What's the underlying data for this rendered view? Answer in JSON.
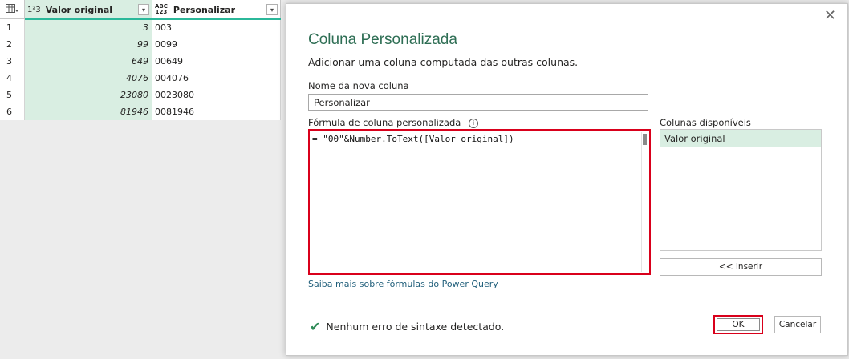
{
  "grid": {
    "columns": [
      {
        "type_label": "1²3",
        "name": "Valor original"
      },
      {
        "type_label": "ABC 123",
        "type_top": "ABC",
        "type_bottom": "123",
        "name": "Personalizar"
      }
    ],
    "rows": [
      {
        "index": "1",
        "valor": "3",
        "personalizar": "003"
      },
      {
        "index": "2",
        "valor": "99",
        "personalizar": "0099"
      },
      {
        "index": "3",
        "valor": "649",
        "personalizar": "00649"
      },
      {
        "index": "4",
        "valor": "4076",
        "personalizar": "004076"
      },
      {
        "index": "5",
        "valor": "23080",
        "personalizar": "0023080"
      },
      {
        "index": "6",
        "valor": "81946",
        "personalizar": "0081946"
      }
    ],
    "accent_color": "#2bb89a"
  },
  "dialog": {
    "title": "Coluna Personalizada",
    "subtitle": "Adicionar uma coluna computada das outras colunas.",
    "name_label": "Nome da nova coluna",
    "name_value": "Personalizar",
    "formula_label": "Fórmula de coluna personalizada",
    "formula_value": "= \"00\"&Number.ToText([Valor original])",
    "available_label": "Colunas disponíveis",
    "available_columns": [
      "Valor original"
    ],
    "insert_label": "<< Inserir",
    "help_link": "Saiba mais sobre fórmulas do Power Query",
    "status": "Nenhum erro de sintaxe detectado.",
    "ok_label": "OK",
    "cancel_label": "Cancelar",
    "title_color": "#2e6e54",
    "highlight_color": "#d9001b"
  },
  "icons": [
    "table-icon",
    "number-type-icon",
    "any-type-icon",
    "dropdown-icon",
    "close-icon",
    "info-icon",
    "check-icon"
  ]
}
